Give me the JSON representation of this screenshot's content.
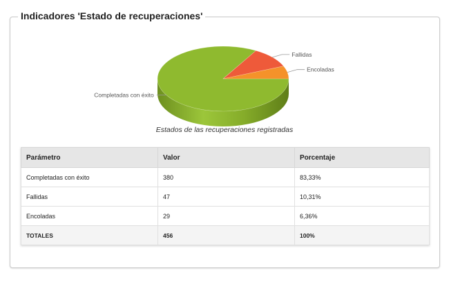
{
  "panel": {
    "title": "Indicadores 'Estado de recuperaciones'"
  },
  "chart_data": {
    "type": "pie",
    "title": "",
    "caption": "Estados de las recuperaciones registradas",
    "slices": [
      {
        "label": "Completadas con éxito",
        "value": 380,
        "color": "#8fba2f"
      },
      {
        "label": "Fallidas",
        "value": 47,
        "color": "#ee5a3a"
      },
      {
        "label": "Encoladas",
        "value": 29,
        "color": "#f5922a"
      }
    ],
    "three_d": true
  },
  "table": {
    "headers": [
      "Parámetro",
      "Valor",
      "Porcentaje"
    ],
    "rows": [
      [
        "Completadas con éxito",
        "380",
        "83,33%"
      ],
      [
        "Fallidas",
        "47",
        "10,31%"
      ],
      [
        "Encoladas",
        "29",
        "6,36%"
      ]
    ],
    "totals": [
      "TOTALES",
      "456",
      "100%"
    ]
  }
}
